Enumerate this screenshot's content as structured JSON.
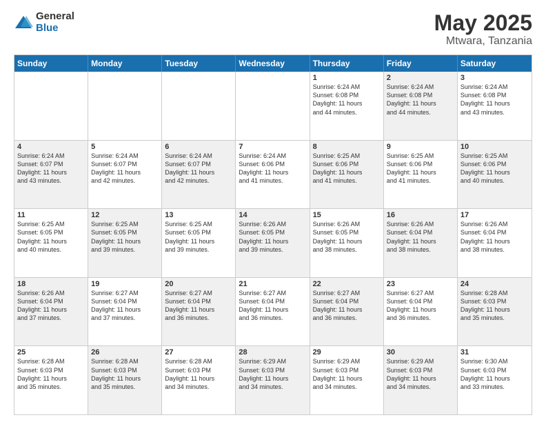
{
  "logo": {
    "general": "General",
    "blue": "Blue"
  },
  "title": {
    "month_year": "May 2025",
    "location": "Mtwara, Tanzania"
  },
  "header_days": [
    "Sunday",
    "Monday",
    "Tuesday",
    "Wednesday",
    "Thursday",
    "Friday",
    "Saturday"
  ],
  "rows": [
    [
      {
        "day": "",
        "text": "",
        "shaded": false
      },
      {
        "day": "",
        "text": "",
        "shaded": false
      },
      {
        "day": "",
        "text": "",
        "shaded": false
      },
      {
        "day": "",
        "text": "",
        "shaded": false
      },
      {
        "day": "1",
        "text": "Sunrise: 6:24 AM\nSunset: 6:08 PM\nDaylight: 11 hours\nand 44 minutes.",
        "shaded": false
      },
      {
        "day": "2",
        "text": "Sunrise: 6:24 AM\nSunset: 6:08 PM\nDaylight: 11 hours\nand 44 minutes.",
        "shaded": true
      },
      {
        "day": "3",
        "text": "Sunrise: 6:24 AM\nSunset: 6:08 PM\nDaylight: 11 hours\nand 43 minutes.",
        "shaded": false
      }
    ],
    [
      {
        "day": "4",
        "text": "Sunrise: 6:24 AM\nSunset: 6:07 PM\nDaylight: 11 hours\nand 43 minutes.",
        "shaded": true
      },
      {
        "day": "5",
        "text": "Sunrise: 6:24 AM\nSunset: 6:07 PM\nDaylight: 11 hours\nand 42 minutes.",
        "shaded": false
      },
      {
        "day": "6",
        "text": "Sunrise: 6:24 AM\nSunset: 6:07 PM\nDaylight: 11 hours\nand 42 minutes.",
        "shaded": true
      },
      {
        "day": "7",
        "text": "Sunrise: 6:24 AM\nSunset: 6:06 PM\nDaylight: 11 hours\nand 41 minutes.",
        "shaded": false
      },
      {
        "day": "8",
        "text": "Sunrise: 6:25 AM\nSunset: 6:06 PM\nDaylight: 11 hours\nand 41 minutes.",
        "shaded": true
      },
      {
        "day": "9",
        "text": "Sunrise: 6:25 AM\nSunset: 6:06 PM\nDaylight: 11 hours\nand 41 minutes.",
        "shaded": false
      },
      {
        "day": "10",
        "text": "Sunrise: 6:25 AM\nSunset: 6:06 PM\nDaylight: 11 hours\nand 40 minutes.",
        "shaded": true
      }
    ],
    [
      {
        "day": "11",
        "text": "Sunrise: 6:25 AM\nSunset: 6:05 PM\nDaylight: 11 hours\nand 40 minutes.",
        "shaded": false
      },
      {
        "day": "12",
        "text": "Sunrise: 6:25 AM\nSunset: 6:05 PM\nDaylight: 11 hours\nand 39 minutes.",
        "shaded": true
      },
      {
        "day": "13",
        "text": "Sunrise: 6:25 AM\nSunset: 6:05 PM\nDaylight: 11 hours\nand 39 minutes.",
        "shaded": false
      },
      {
        "day": "14",
        "text": "Sunrise: 6:26 AM\nSunset: 6:05 PM\nDaylight: 11 hours\nand 39 minutes.",
        "shaded": true
      },
      {
        "day": "15",
        "text": "Sunrise: 6:26 AM\nSunset: 6:05 PM\nDaylight: 11 hours\nand 38 minutes.",
        "shaded": false
      },
      {
        "day": "16",
        "text": "Sunrise: 6:26 AM\nSunset: 6:04 PM\nDaylight: 11 hours\nand 38 minutes.",
        "shaded": true
      },
      {
        "day": "17",
        "text": "Sunrise: 6:26 AM\nSunset: 6:04 PM\nDaylight: 11 hours\nand 38 minutes.",
        "shaded": false
      }
    ],
    [
      {
        "day": "18",
        "text": "Sunrise: 6:26 AM\nSunset: 6:04 PM\nDaylight: 11 hours\nand 37 minutes.",
        "shaded": true
      },
      {
        "day": "19",
        "text": "Sunrise: 6:27 AM\nSunset: 6:04 PM\nDaylight: 11 hours\nand 37 minutes.",
        "shaded": false
      },
      {
        "day": "20",
        "text": "Sunrise: 6:27 AM\nSunset: 6:04 PM\nDaylight: 11 hours\nand 36 minutes.",
        "shaded": true
      },
      {
        "day": "21",
        "text": "Sunrise: 6:27 AM\nSunset: 6:04 PM\nDaylight: 11 hours\nand 36 minutes.",
        "shaded": false
      },
      {
        "day": "22",
        "text": "Sunrise: 6:27 AM\nSunset: 6:04 PM\nDaylight: 11 hours\nand 36 minutes.",
        "shaded": true
      },
      {
        "day": "23",
        "text": "Sunrise: 6:27 AM\nSunset: 6:04 PM\nDaylight: 11 hours\nand 36 minutes.",
        "shaded": false
      },
      {
        "day": "24",
        "text": "Sunrise: 6:28 AM\nSunset: 6:03 PM\nDaylight: 11 hours\nand 35 minutes.",
        "shaded": true
      }
    ],
    [
      {
        "day": "25",
        "text": "Sunrise: 6:28 AM\nSunset: 6:03 PM\nDaylight: 11 hours\nand 35 minutes.",
        "shaded": false
      },
      {
        "day": "26",
        "text": "Sunrise: 6:28 AM\nSunset: 6:03 PM\nDaylight: 11 hours\nand 35 minutes.",
        "shaded": true
      },
      {
        "day": "27",
        "text": "Sunrise: 6:28 AM\nSunset: 6:03 PM\nDaylight: 11 hours\nand 34 minutes.",
        "shaded": false
      },
      {
        "day": "28",
        "text": "Sunrise: 6:29 AM\nSunset: 6:03 PM\nDaylight: 11 hours\nand 34 minutes.",
        "shaded": true
      },
      {
        "day": "29",
        "text": "Sunrise: 6:29 AM\nSunset: 6:03 PM\nDaylight: 11 hours\nand 34 minutes.",
        "shaded": false
      },
      {
        "day": "30",
        "text": "Sunrise: 6:29 AM\nSunset: 6:03 PM\nDaylight: 11 hours\nand 34 minutes.",
        "shaded": true
      },
      {
        "day": "31",
        "text": "Sunrise: 6:30 AM\nSunset: 6:03 PM\nDaylight: 11 hours\nand 33 minutes.",
        "shaded": false
      }
    ]
  ]
}
